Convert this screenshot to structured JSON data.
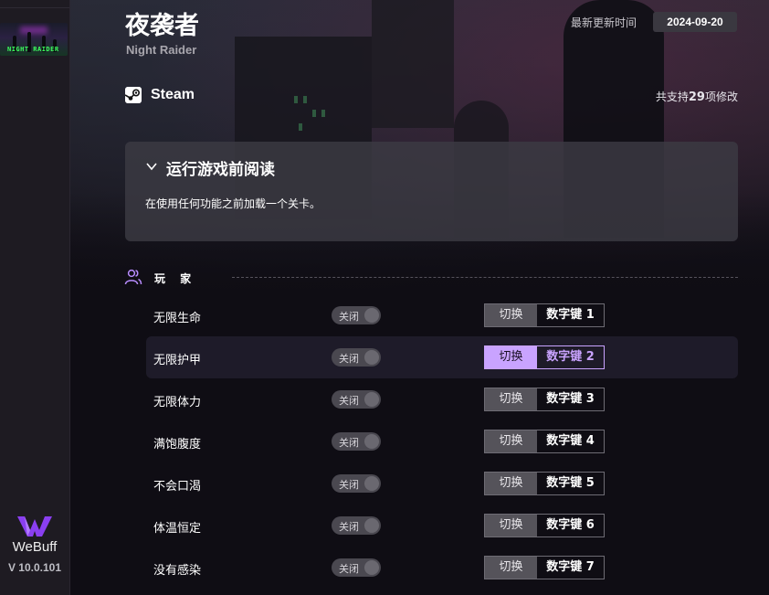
{
  "brand": {
    "name": "WeBuff",
    "version": "V 10.0.101",
    "accent_color": "#8a3ff0"
  },
  "sidebar": {
    "games": [
      {
        "thumb_text": "NIGHT RAIDER"
      }
    ]
  },
  "game": {
    "title": "夜袭者",
    "subtitle": "Night Raider",
    "update_label": "最新更新时间",
    "update_date": "2024-09-20",
    "platform": "Steam",
    "platform_icon": "steam-icon",
    "support_prefix": "共支持",
    "support_count": "29",
    "support_suffix": "项修改"
  },
  "notice": {
    "title": "运行游戏前阅读",
    "body": "在使用任何功能之前加载一个关卡。",
    "icon": "chevron-down-icon"
  },
  "section": {
    "title": "玩 家",
    "icon": "users-icon"
  },
  "cheats": [
    {
      "name": "无限生命",
      "toggle": "关闭",
      "switch": "切换",
      "key": "数字键 1",
      "active": false
    },
    {
      "name": "无限护甲",
      "toggle": "关闭",
      "switch": "切换",
      "key": "数字键 2",
      "active": true
    },
    {
      "name": "无限体力",
      "toggle": "关闭",
      "switch": "切换",
      "key": "数字键 3",
      "active": false
    },
    {
      "name": "满饱腹度",
      "toggle": "关闭",
      "switch": "切换",
      "key": "数字键 4",
      "active": false
    },
    {
      "name": "不会口渴",
      "toggle": "关闭",
      "switch": "切换",
      "key": "数字键 5",
      "active": false
    },
    {
      "name": "体温恒定",
      "toggle": "关闭",
      "switch": "切换",
      "key": "数字键 6",
      "active": false
    },
    {
      "name": "没有感染",
      "toggle": "关闭",
      "switch": "切换",
      "key": "数字键 7",
      "active": false
    }
  ]
}
